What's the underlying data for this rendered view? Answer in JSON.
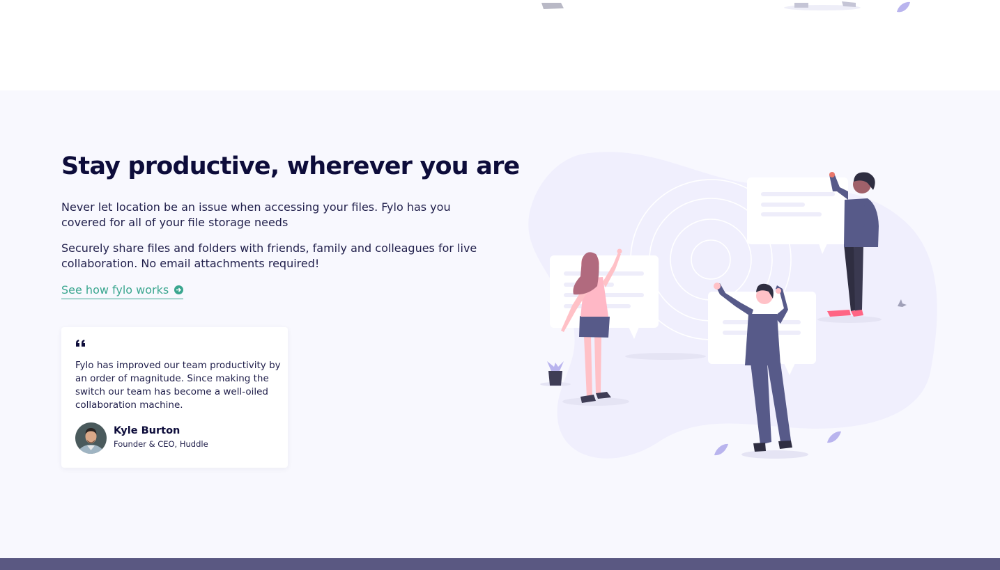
{
  "feature": {
    "title": "Stay productive, wherever you are",
    "paragraph_1": "Never let location be an issue when accessing your files. Fylo has you covered for all of your file storage needs",
    "paragraph_2": "Securely share files and folders with friends, family and colleagues for live collaboration. No email attachments required!",
    "link_label": "See how fylo works",
    "link_icon": "arrow-circle-right-icon"
  },
  "testimonial": {
    "quote_icon": "quote-icon",
    "text": "Fylo has improved our team productivity by an order of magnitude. Since making the switch our team has become a well-oiled collaboration machine.",
    "author_name": "Kyle Burton",
    "author_role": "Founder & CEO, Huddle"
  },
  "colors": {
    "accent": "#3aa68f",
    "heading": "#0d0c3a",
    "section_bg": "#f8f8fe",
    "footer": "#5a5882"
  }
}
